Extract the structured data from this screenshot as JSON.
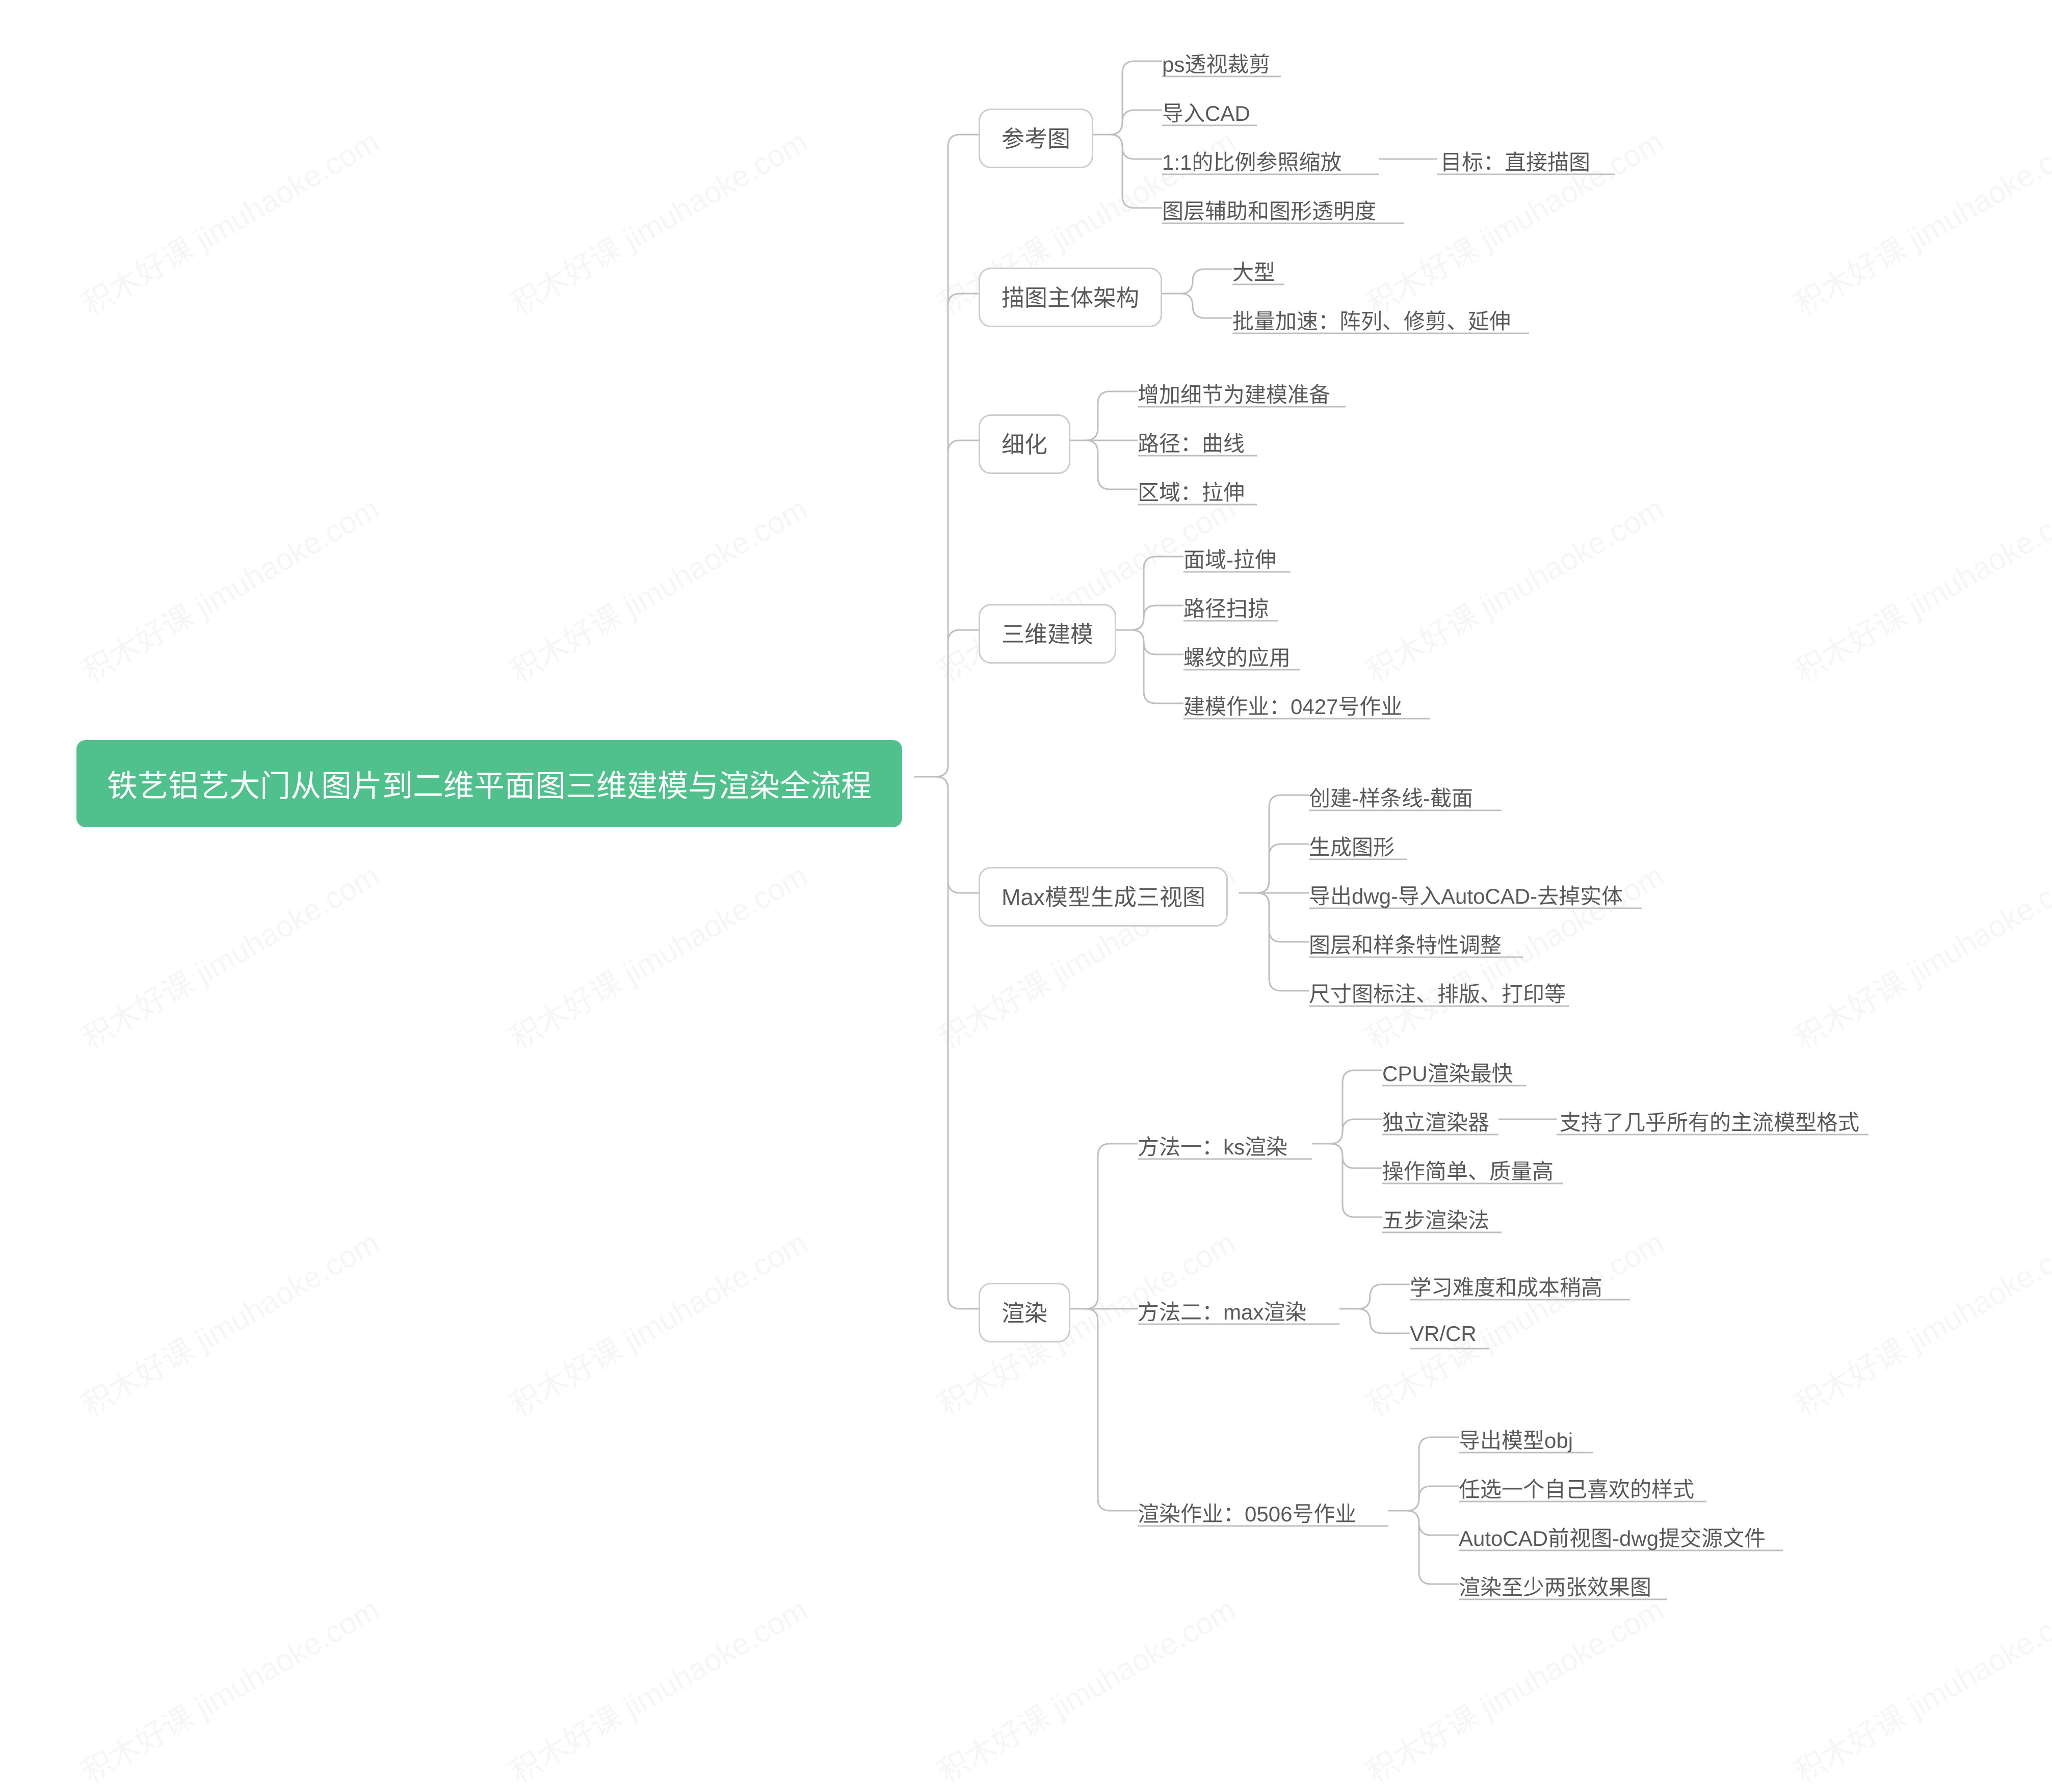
{
  "watermark": "积木好课 jimuhaoke.com",
  "root": "铁艺铝艺大门从图片到二维平面图三维建模与渲染全流程",
  "branches": {
    "b1": {
      "label": "参考图",
      "leaves": {
        "l1": "ps透视裁剪",
        "l2": "导入CAD",
        "l3": "1:1的比例参照缩放",
        "l3a": "目标：直接描图",
        "l4": "图层辅助和图形透明度"
      }
    },
    "b2": {
      "label": "描图主体架构",
      "leaves": {
        "l1": "大型",
        "l2": "批量加速：阵列、修剪、延伸"
      }
    },
    "b3": {
      "label": "细化",
      "leaves": {
        "l1": "增加细节为建模准备",
        "l2": "路径：曲线",
        "l3": "区域：拉伸"
      }
    },
    "b4": {
      "label": "三维建模",
      "leaves": {
        "l1": "面域-拉伸",
        "l2": "路径扫掠",
        "l3": "螺纹的应用",
        "l4": "建模作业：0427号作业"
      }
    },
    "b5": {
      "label": "Max模型生成三视图",
      "leaves": {
        "l1": "创建-样条线-截面",
        "l2": "生成图形",
        "l3": "导出dwg-导入AutoCAD-去掉实体",
        "l4": "图层和样条特性调整",
        "l5": "尺寸图标注、排版、打印等"
      }
    },
    "b6": {
      "label": "渲染",
      "subs": {
        "s1": {
          "label": "方法一：ks渲染",
          "leaves": {
            "l1": "CPU渲染最快",
            "l2": "独立渲染器",
            "l2a": "支持了几乎所有的主流模型格式",
            "l3": "操作简单、质量高",
            "l4": "五步渲染法"
          }
        },
        "s2": {
          "label": "方法二：max渲染",
          "leaves": {
            "l1": "学习难度和成本稍高",
            "l2": "VR/CR"
          }
        },
        "s3": {
          "label": "渲染作业：0506号作业",
          "leaves": {
            "l1": "导出模型obj",
            "l2": "任选一个自己喜欢的样式",
            "l3": "AutoCAD前视图-dwg提交源文件",
            "l4": "渲染至少两张效果图"
          }
        }
      }
    }
  }
}
